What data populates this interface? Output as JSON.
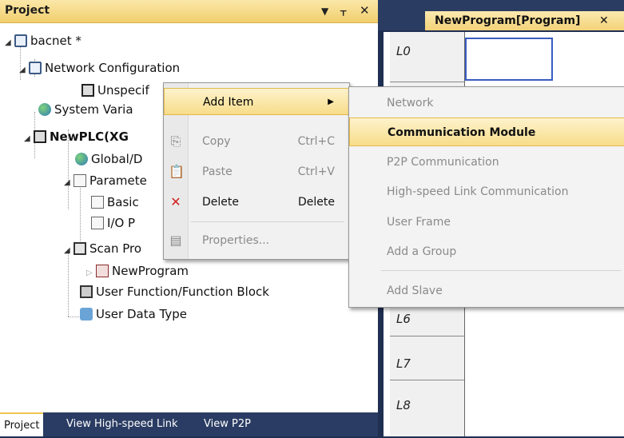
{
  "project_panel": {
    "title": "Project",
    "controls": {
      "dropdown": "▼",
      "pin": "ᚁ",
      "close": "✕"
    },
    "tree": [
      {
        "label": "bacnet *"
      },
      {
        "label": "Network Configuration"
      },
      {
        "label": "Unspecif"
      },
      {
        "label": "System Varia"
      },
      {
        "label": "NewPLC(XG"
      },
      {
        "label": "Global/D"
      },
      {
        "label": "Paramete"
      },
      {
        "label": "Basic"
      },
      {
        "label": "I/O P"
      },
      {
        "label": "Scan Pro"
      },
      {
        "label": "NewProgram"
      },
      {
        "label": "User Function/Function Block"
      },
      {
        "label": "User Data Type"
      }
    ],
    "bottom_tabs": [
      "Project",
      "View High-speed Link",
      "View P2P"
    ]
  },
  "editor": {
    "tab_label": "NewProgram[Program]",
    "tab_close": "✕",
    "rungs": [
      "L0",
      "L6",
      "L7",
      "L8"
    ]
  },
  "context_menu": {
    "items": [
      {
        "label": "Add Item",
        "shortcut": "",
        "arrow": "▶"
      },
      {
        "label": "Copy",
        "shortcut": "Ctrl+C"
      },
      {
        "label": "Paste",
        "shortcut": "Ctrl+V"
      },
      {
        "label": "Delete",
        "shortcut": "Delete"
      },
      {
        "label": "Properties..."
      }
    ]
  },
  "submenu": {
    "items": [
      "Network",
      "Communication Module",
      "P2P Communication",
      "High-speed Link Communication",
      "User Frame",
      "Add a Group",
      "Add Slave"
    ]
  }
}
